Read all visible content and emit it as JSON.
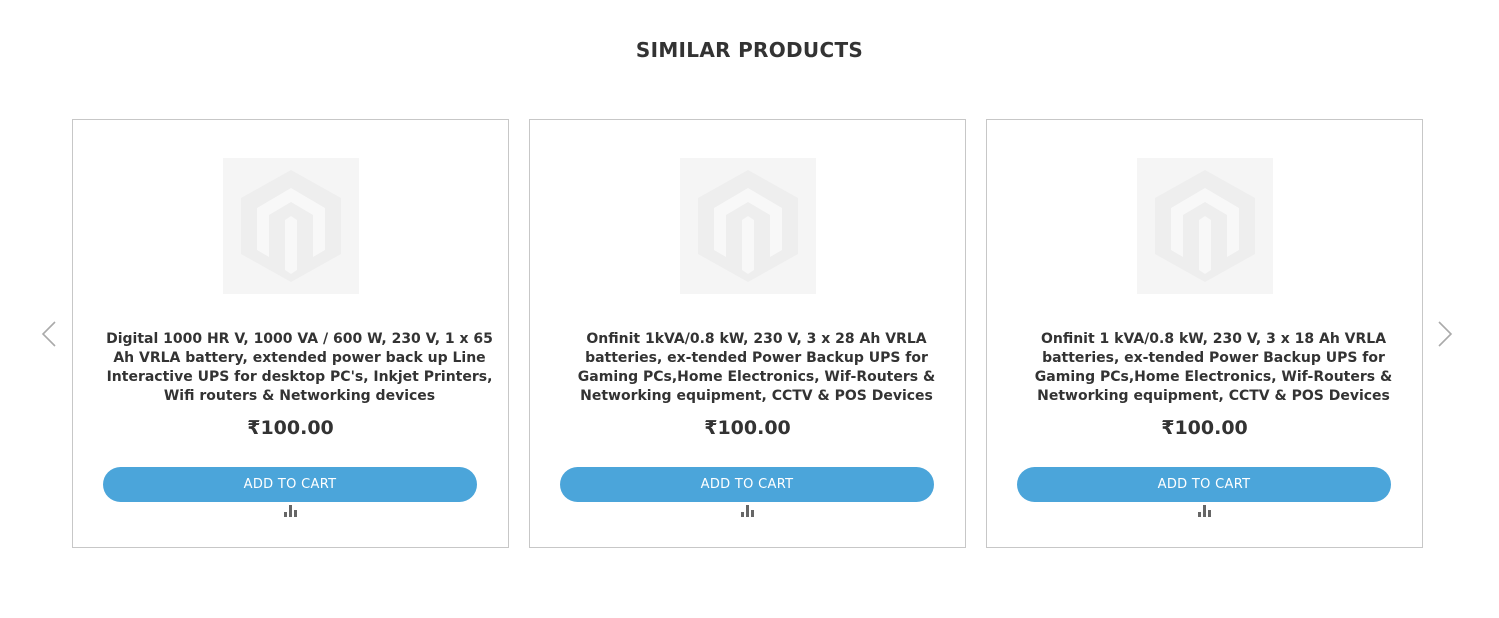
{
  "section": {
    "title": "SIMILAR PRODUCTS"
  },
  "carousel": {
    "prev_icon": "chevron-left-icon",
    "next_icon": "chevron-right-icon"
  },
  "products": [
    {
      "name": "Digital 1000 HR V, 1000 VA / 600 W, 230 V, 1 x 65 Ah VRLA battery, extended power back up Line Interactive UPS for desktop PC's, Inkjet Printers, Wifi routers & Networking devices",
      "price": "₹100.00",
      "cart_label": "ADD TO CART",
      "image_icon": "magento-placeholder-icon",
      "compare_icon": "compare-icon"
    },
    {
      "name": "Onfinit 1kVA/0.8 kW, 230 V, 3 x 28 Ah VRLA batteries, ex-tended Power Backup UPS for Gaming PCs,Home Electronics, Wif-Routers & Networking equipment, CCTV & POS Devices",
      "price": "₹100.00",
      "cart_label": "ADD TO CART",
      "image_icon": "magento-placeholder-icon",
      "compare_icon": "compare-icon"
    },
    {
      "name": "Onfinit 1 kVA/0.8 kW, 230 V, 3 x 18 Ah VRLA batteries, ex-tended Power Backup UPS for Gaming PCs,Home Electronics, Wif-Routers & Networking equipment, CCTV & POS Devices",
      "price": "₹100.00",
      "cart_label": "ADD TO CART",
      "image_icon": "magento-placeholder-icon",
      "compare_icon": "compare-icon"
    }
  ],
  "colors": {
    "accent": "#4ba5da",
    "border": "#c7c7c7",
    "text": "#333333"
  }
}
